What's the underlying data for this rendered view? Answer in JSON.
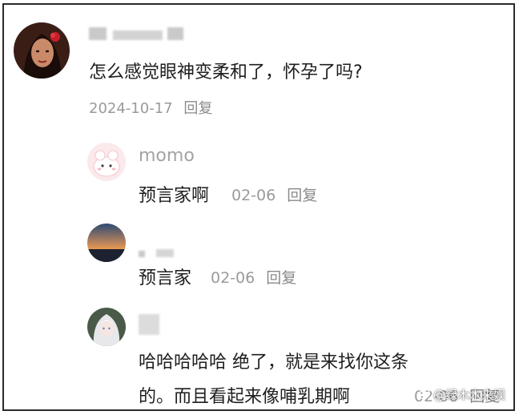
{
  "main_comment": {
    "avatar_icon": "user-avatar-woman-red-flower",
    "text": "怎么感觉眼神变柔和了，怀孕了吗?",
    "date": "2024-10-17",
    "reply_label": "回复"
  },
  "replies": [
    {
      "avatar_icon": "user-avatar-pink-cartoon",
      "username": "momo",
      "text": "预言家啊",
      "date": "02-06",
      "reply_label": "回复"
    },
    {
      "avatar_icon": "user-avatar-sunset",
      "text": "预言家",
      "date": "02-06",
      "reply_label": "回复"
    },
    {
      "avatar_icon": "user-avatar-anime-girl",
      "text_line1": "哈哈哈哈哈 绝了，就是来找你这条",
      "text_line2": "的。而且看起来像哺乳期啊",
      "date": "02-06",
      "reply_label": "回复"
    }
  ],
  "watermark": {
    "icon": "weibo-icon",
    "text": "@绿木木来娱"
  }
}
